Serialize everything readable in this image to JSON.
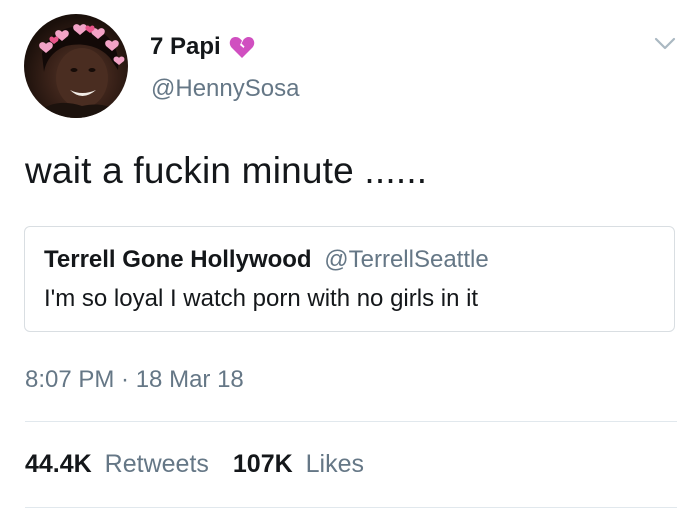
{
  "tweet": {
    "display_name": "7 Papi",
    "name_emoji": "broken-heart-icon",
    "handle": "@HennySosa",
    "text": "wait a fuckin minute ......",
    "quoted": {
      "display_name": "Terrell Gone Hollywood",
      "handle": "@TerrellSeattle",
      "text": "I'm so loyal I watch porn with no girls in it"
    },
    "timestamp": "8:07 PM · 18 Mar 18",
    "stats": {
      "retweets_count": "44.4K",
      "retweets_label": "Retweets",
      "likes_count": "107K",
      "likes_label": "Likes"
    }
  },
  "colors": {
    "primary_text": "#14171a",
    "secondary_text": "#657786",
    "border": "#d9dee2",
    "heart": "#d04fc0"
  },
  "icons": {
    "menu": "chevron-down-icon",
    "avatar": "avatar-image"
  }
}
